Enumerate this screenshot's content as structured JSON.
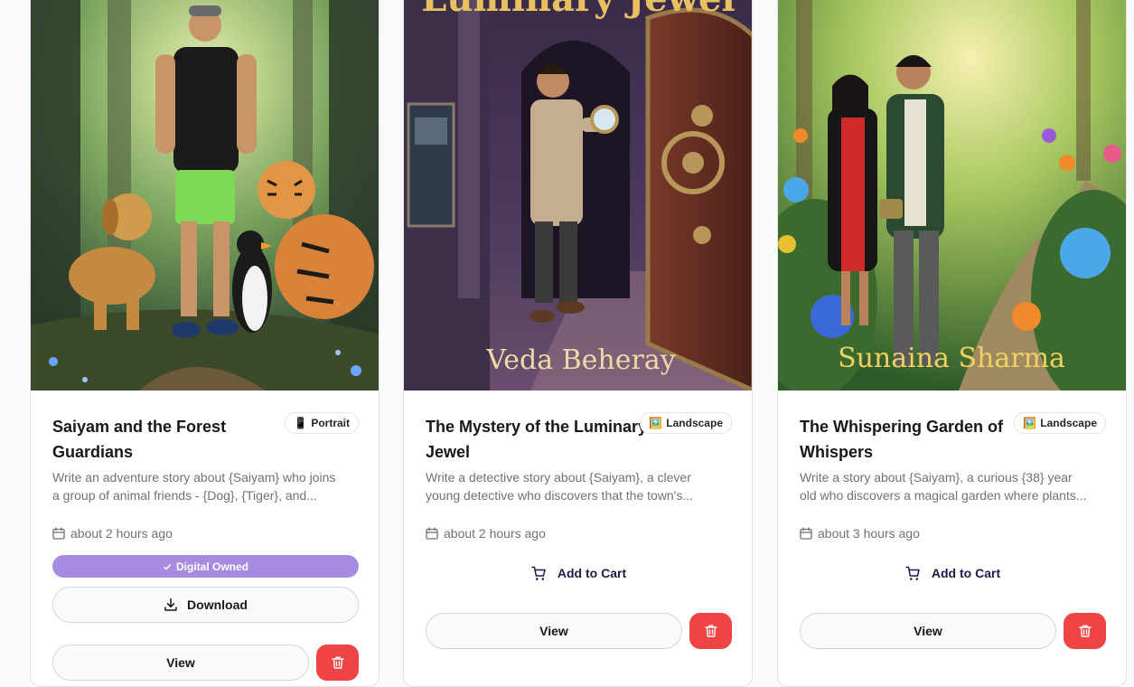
{
  "cards": [
    {
      "title": "Saiyam and the Forest Guardians",
      "badge_icon": "📱",
      "badge_label": "Portrait",
      "desc_line1": "Write an adventure story about {Saiyam} who joins",
      "desc_line2": "a group of animal friends - {Dog}, {Tiger}, and...",
      "date": "about 2 hours ago",
      "owned_label": "Digital Owned",
      "download_label": "Download",
      "view_label": "View"
    },
    {
      "title": "The Mystery of the Luminary Jewel",
      "badge_icon": "🖼️",
      "badge_label": "Landscape",
      "desc_line1": "Write a detective story about {Saiyam}, a clever",
      "desc_line2": "young detective who discovers that the town's...",
      "date": "about 2 hours ago",
      "cart_label": "Add to Cart",
      "view_label": "View",
      "cover_title": "Luminary Jewel",
      "cover_author": "Veda Beheray"
    },
    {
      "title": "The Whispering Garden of Whispers",
      "badge_icon": "🖼️",
      "badge_label": "Landscape",
      "desc_line1": "Write a story about {Saiyam}, a curious {38} year",
      "desc_line2": "old who discovers a magical garden where plants...",
      "date": "about 3 hours ago",
      "cart_label": "Add to Cart",
      "view_label": "View",
      "cover_author": "Sunaina Sharma"
    }
  ],
  "colors": {
    "owned": "#a78be0",
    "delete": "#ef4444",
    "cart_text": "#1e1b4b"
  }
}
